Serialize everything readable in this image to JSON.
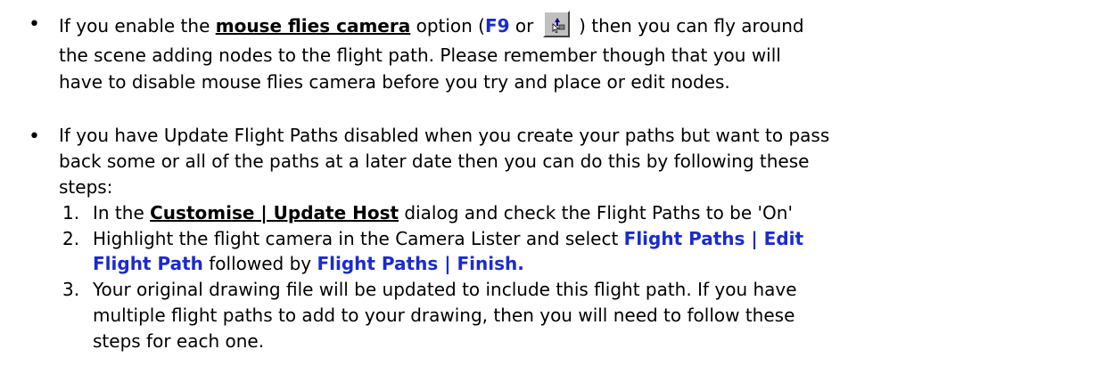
{
  "bullet1": {
    "pre": "If you enable the ",
    "link": "mouse flies camera",
    "mid": " option   (",
    "key": "F9",
    "or": " or ",
    "icon": "mouse-camera-icon",
    "post": " ) then you can fly around",
    "line2": "the scene adding nodes to the flight path.   Please remember though that you will",
    "line3": "have to disable mouse flies camera before you try and place or edit nodes."
  },
  "bullet2": {
    "line1": "If you have Update Flight Paths disabled when you create your paths but want to pass",
    "line2": "back some or all of the paths at a later date then you can do this by following these",
    "line3": "steps:",
    "steps": [
      {
        "num": "1.",
        "pre": "In the ",
        "link": "Customise | Update Host",
        "post": " dialog and check the Flight Paths to be 'On'"
      },
      {
        "num": "2.",
        "pre": "Highlight the flight camera in the Camera Lister and select ",
        "cmd1a": "Flight Paths | Edit",
        "cmd1b": "Flight Path",
        "mid": " followed by ",
        "cmd2": "Flight Paths | Finish."
      },
      {
        "num": "3.",
        "line1": "Your original drawing file will be updated to include this flight path.   If you have",
        "line2": "multiple flight paths to add to your drawing, then you will need to follow these",
        "line3": "steps for each one."
      }
    ]
  },
  "colors": {
    "accent": "#1a2bcf",
    "text": "#000000"
  }
}
